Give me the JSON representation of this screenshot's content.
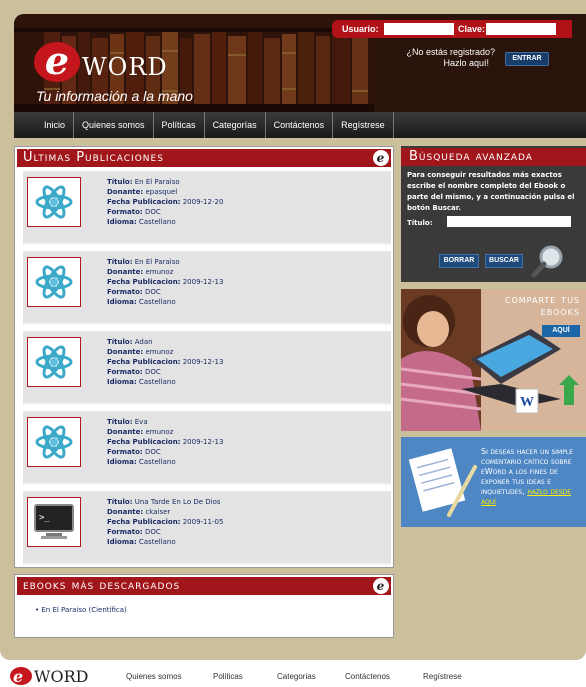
{
  "header": {
    "logo_letter": "e",
    "logo_word": "WORD",
    "tagline": "Tu información a la mano",
    "login": {
      "user_label": "Usuario:",
      "pass_label": "Clave:",
      "not_registered": "¿No estás registrado?",
      "register_here": "Hazlo aquí!",
      "enter_button": "ENTRAR"
    }
  },
  "nav": {
    "items": [
      "Inicio",
      "Quienes somos",
      "Políticas",
      "Categorías",
      "Contáctenos",
      "Regístrese"
    ]
  },
  "latest": {
    "title": "Últimas Publicaciones",
    "icon_letter": "e",
    "field_labels": {
      "title": "Título:",
      "donor": "Donante:",
      "date": "Fecha Publicacion:",
      "format": "Formato:",
      "language": "Idioma:"
    },
    "items": [
      {
        "title": "En El Paraiso",
        "donor": "epasquel",
        "date": "2009-12-20",
        "format": "DOC",
        "language": "Castellano",
        "icon": "atom-icon"
      },
      {
        "title": "En El Paraiso",
        "donor": "emunoz",
        "date": "2009-12-13",
        "format": "DOC",
        "language": "Castellano",
        "icon": "atom-icon"
      },
      {
        "title": "Adan",
        "donor": "emunoz",
        "date": "2009-12-13",
        "format": "DOC",
        "language": "Castellano",
        "icon": "atom-icon"
      },
      {
        "title": "Eva",
        "donor": "emunoz",
        "date": "2009-12-13",
        "format": "DOC",
        "language": "Castellano",
        "icon": "atom-icon"
      },
      {
        "title": "Una Tarde En Lo De Dios",
        "donor": "ckaiser",
        "date": "2009-11-05",
        "format": "DOC",
        "language": "Castellano",
        "icon": "terminal-icon"
      }
    ]
  },
  "most_downloaded": {
    "title": "ebooks más descargados",
    "items": [
      "• En El Paraiso (Científica)"
    ]
  },
  "search": {
    "title": "Búsqueda avanzada",
    "description": "Para conseguir resultados más exactos escribe el nombre completo del Ebook o parte del mismo, y a continuación pulsa el botón Buscar.",
    "titulo_label": "Título:",
    "clear_button": "BORRAR",
    "search_button": "BUSCAR"
  },
  "share": {
    "title_line1": "comparte tus",
    "title_line2": "ebooks",
    "button": "AQUÍ"
  },
  "comment": {
    "text": "Si deseas hacer un simple comentario crítico sobre eWord a los fines de exponer tus ideas e inquietudes,",
    "link": "hazlo desde aquí"
  },
  "footer": {
    "logo_word": "WORD",
    "links": [
      "Quienes somos",
      "Politicas",
      "Categorias",
      "Contáctenos",
      "Regístrese"
    ]
  },
  "colors": {
    "brand_red": "#a1161b",
    "frame": "#cbbf9c",
    "nav_dark": "#1a1a1a",
    "link_blue": "#1b2c66"
  }
}
